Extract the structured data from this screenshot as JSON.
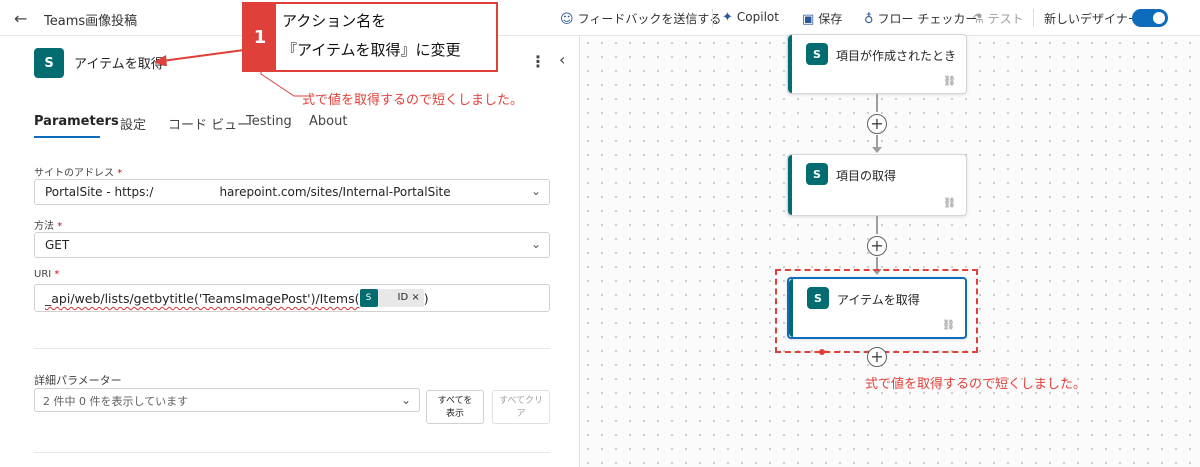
{
  "header": {
    "title": "Teams画像投稿",
    "feedback": "フィードバックを送信する",
    "copilot": "Copilot",
    "save": "保存",
    "flow_checker": "フロー チェッカー",
    "test": "テスト",
    "new_designer": "新しいデザイナー",
    "new_designer_on": true
  },
  "panel": {
    "action_name": "アイテムを取得",
    "tabs": [
      "Parameters",
      "設定",
      "コード ビュー",
      "Testing",
      "About"
    ],
    "active_tab": "Parameters",
    "site_label": "サイトのアドレス",
    "site_value_prefix": "PortalSite - https:/",
    "site_value_suffix": "harepoint.com/sites/Internal-PortalSite",
    "method_label": "方法",
    "method_value": "GET",
    "uri_label": "URI",
    "uri_prefix": "_api/web/lists/getbytitle('TeamsImagePost')/Items(",
    "uri_token": "ID",
    "uri_token_close": "×",
    "uri_suffix": ")",
    "advanced_label": "詳細パラメーター",
    "advanced_value": "2 件中 0 件を表示しています",
    "show_all_line1": "すべてを",
    "show_all_line2": "表示",
    "clear_all_line1": "すべてクリ",
    "clear_all_line2": "ア",
    "required_mark": "*"
  },
  "canvas": {
    "nodes": [
      {
        "title": "項目が作成されたとき"
      },
      {
        "title": "項目の取得"
      },
      {
        "title": "アイテムを取得"
      }
    ]
  },
  "annotations": {
    "callout_number": "1",
    "callout_line1": "アクション名を",
    "callout_line2": "『アイテムを取得』に変更",
    "note_panel": "式で値を取得するので短くしました。",
    "note_canvas": "式で値を取得するので短くしました。",
    "accent_color": "#e0403a"
  },
  "icons": {
    "sharepoint": "S"
  }
}
